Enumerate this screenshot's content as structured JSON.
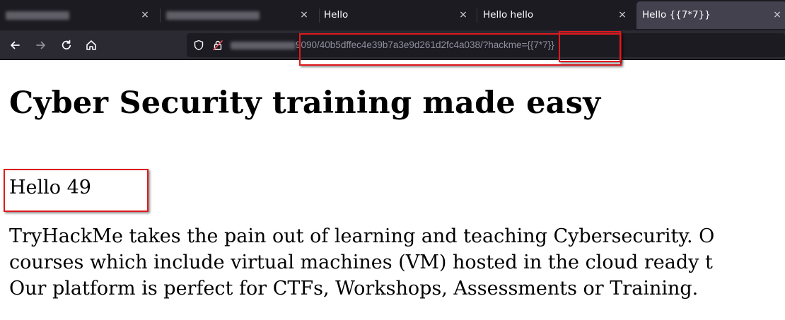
{
  "tabs": [
    {
      "label": "",
      "blurred": true
    },
    {
      "label": "",
      "blurred": true
    },
    {
      "label": "Hello"
    },
    {
      "label": "Hello hello"
    },
    {
      "label": "Hello {{7*7}}",
      "active": true
    }
  ],
  "tab_close_glyph": "×",
  "nav": {
    "back_icon": "arrow-left-icon",
    "forward_icon": "arrow-right-icon",
    "reload_icon": "reload-icon",
    "home_icon": "home-icon"
  },
  "url": {
    "path": "9090/40b5dffec4e39b7a3e9d261d2fc4a038/?hackme=",
    "payload": "{{7*7}}"
  },
  "page": {
    "title": "Cyber Security training made easy",
    "greeting": "Hello 49",
    "paragraph_lines": [
      "TryHackMe takes the pain out of learning and teaching Cybersecurity. O",
      "courses which include virtual machines (VM) hosted in the cloud ready t",
      "Our platform is perfect for CTFs, Workshops, Assessments or Training."
    ]
  },
  "colors": {
    "annotation": "#e0191e",
    "chrome_dark": "#1c1b22",
    "toolbar": "#2b2a33",
    "active_tab": "#42414d"
  }
}
